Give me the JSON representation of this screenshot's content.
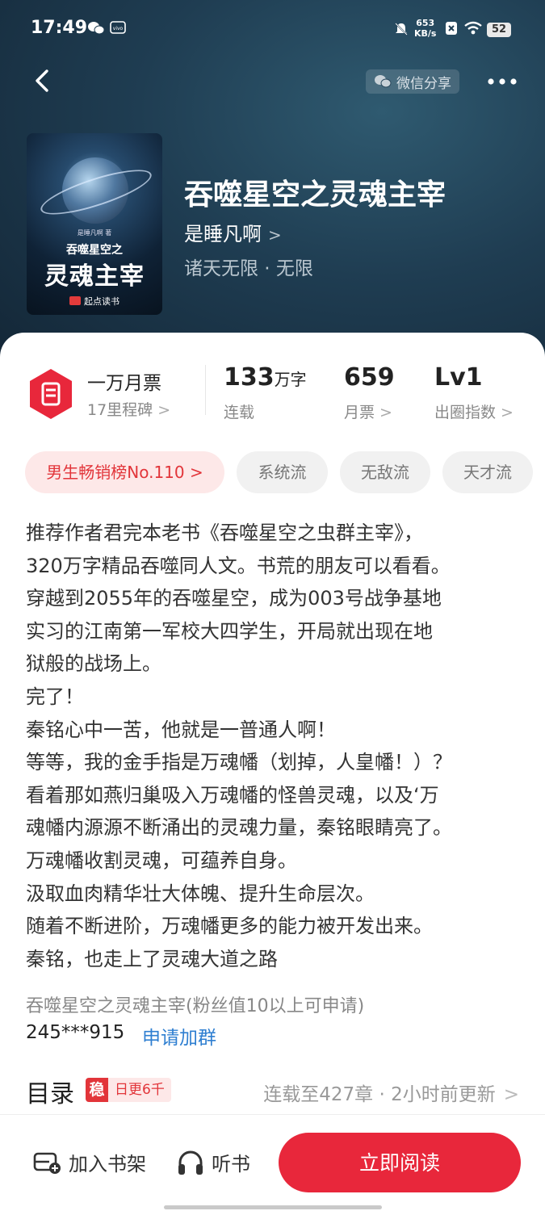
{
  "status_bar": {
    "time": "17:49",
    "speed_value": "653",
    "speed_unit": "KB/s",
    "battery": "52"
  },
  "nav": {
    "share_label": "微信分享"
  },
  "book": {
    "cover": {
      "author_line": "是睡凡啊 著",
      "subtitle": "吞噬星空之",
      "title": "灵魂主宰",
      "publisher": "起点读书"
    },
    "title": "吞噬星空之灵魂主宰",
    "author": "是睡凡啊",
    "tags_line": "诸天无限 · 无限"
  },
  "stats": {
    "ticket": {
      "title": "一万月票",
      "sub": "17里程碑"
    },
    "words": {
      "value": "133",
      "unit": "万字",
      "label": "连载"
    },
    "monthly": {
      "value": "659",
      "label": "月票"
    },
    "level": {
      "value": "Lv1",
      "label": "出圈指数"
    }
  },
  "chips": [
    "男生畅销榜No.110 >",
    "系统流",
    "无敌流",
    "天才流"
  ],
  "description": "推荐作者君完本老书《吞噬星空之虫群主宰》，\n320万字精品吞噬同人文。书荒的朋友可以看看。\n穿越到2055年的吞噬星空，成为003号战争基地\n实习的江南第一军校大四学生，开局就出现在地\n狱般的战场上。\n完了！\n秦铭心中一苦，他就是一普通人啊！\n等等，我的金手指是万魂幡（划掉，人皇幡！）？\n看着那如燕归巢吸入万魂幡的怪兽灵魂，以及‘万\n魂幡内源源不断涌出的灵魂力量，秦铭眼睛亮了。\n万魂幡收割灵魂，可蕴养自身。\n汲取血肉精华壮大体魄、提升生命层次。\n随着不断进阶，万魂幡更多的能力被开发出来。\n秦铭，也走上了灵魂大道之路",
  "group": {
    "line": "吞噬星空之灵魂主宰(粉丝值10以上可申请)",
    "id": "245***915",
    "apply": "申请加群"
  },
  "toc": {
    "title": "目录",
    "badge_char": "稳",
    "badge_text": "日更6千",
    "status": "连载至427章 · 2小时前更新"
  },
  "bottom": {
    "add_shelf": "加入书架",
    "listen": "听书",
    "read_now": "立即阅读"
  },
  "colors": {
    "accent": "#e8273b",
    "link": "#2f7fd1",
    "hero_bg": "#1f3d52"
  }
}
